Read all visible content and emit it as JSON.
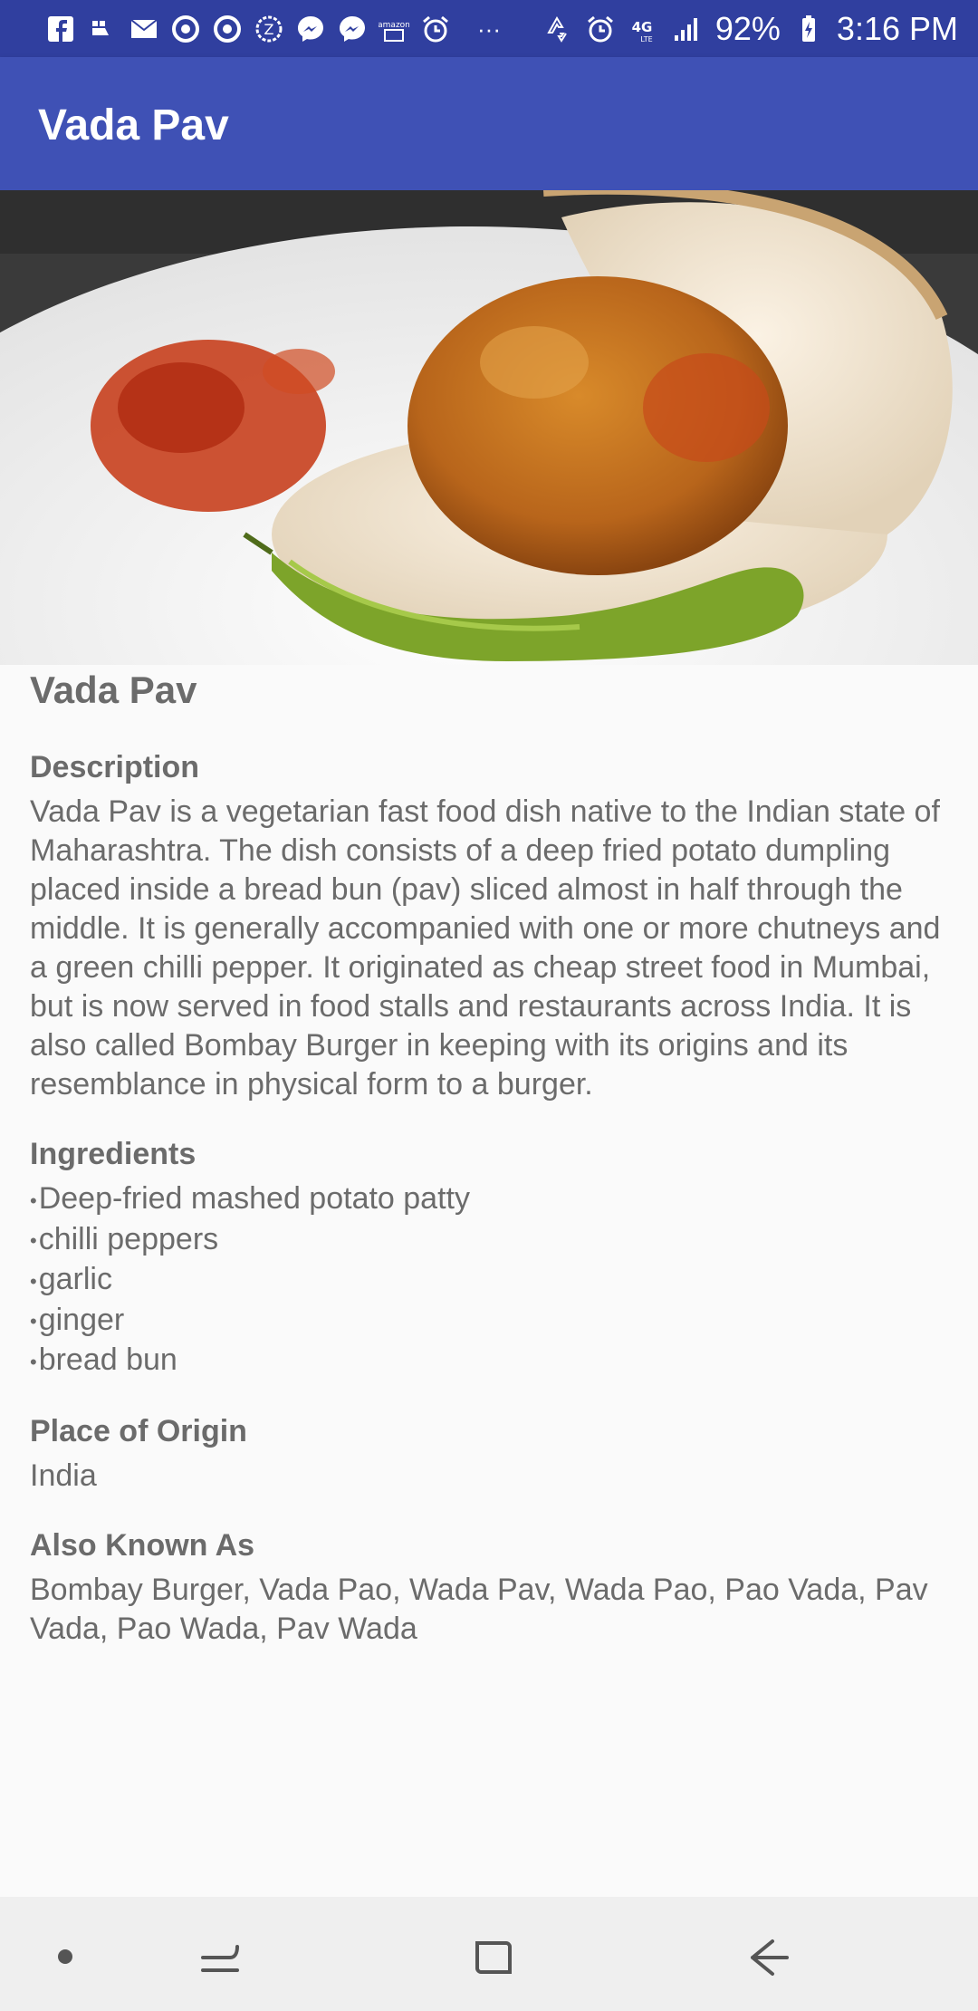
{
  "status_bar": {
    "notification_icons": [
      "facebook-icon",
      "hand-icon",
      "mail-icon",
      "circle-icon",
      "circle-icon",
      "badge-icon",
      "messenger-icon",
      "messenger-icon",
      "amazon-icon",
      "alarm-icon",
      "more-icon"
    ],
    "more_label": "···",
    "battery_percent": "92%",
    "time": "3:16 PM",
    "network": "4G LTE"
  },
  "app_bar": {
    "title": "Vada Pav"
  },
  "hero_image": {
    "description_icon": "food-photo-icon"
  },
  "detail": {
    "title": "Vada Pav",
    "description_heading": "Description",
    "description": "Vada Pav is a vegetarian fast food dish native to the Indian state of Maharashtra. The dish consists of a deep fried potato dumpling placed inside a bread bun (pav) sliced almost in half through the middle. It is generally accompanied with one or more chutneys and a green chilli pepper. It originated as cheap street food in Mumbai, but is now served in food stalls and restaurants across India. It is also called Bombay Burger in keeping with its origins and its resemblance in physical form to a burger.",
    "ingredients_heading": "Ingredients",
    "ingredients": [
      "Deep-fried mashed potato patty",
      "chilli peppers",
      "garlic",
      "ginger",
      "bread bun"
    ],
    "origin_heading": "Place of Origin",
    "origin": "India",
    "aka_heading": "Also Known As",
    "aka": "Bombay Burger, Vada Pao, Wada Pav, Wada Pao, Pao Vada, Pav Vada, Pao Wada, Pav Wada"
  },
  "colors": {
    "status_bar": "#303f9f",
    "app_bar": "#3f51b5",
    "text": "#6b6b6b",
    "background": "#fafafa",
    "nav_bar": "#efefef"
  },
  "nav_bar": {
    "buttons": [
      "dot-icon",
      "recents-icon",
      "home-icon",
      "back-icon"
    ]
  }
}
